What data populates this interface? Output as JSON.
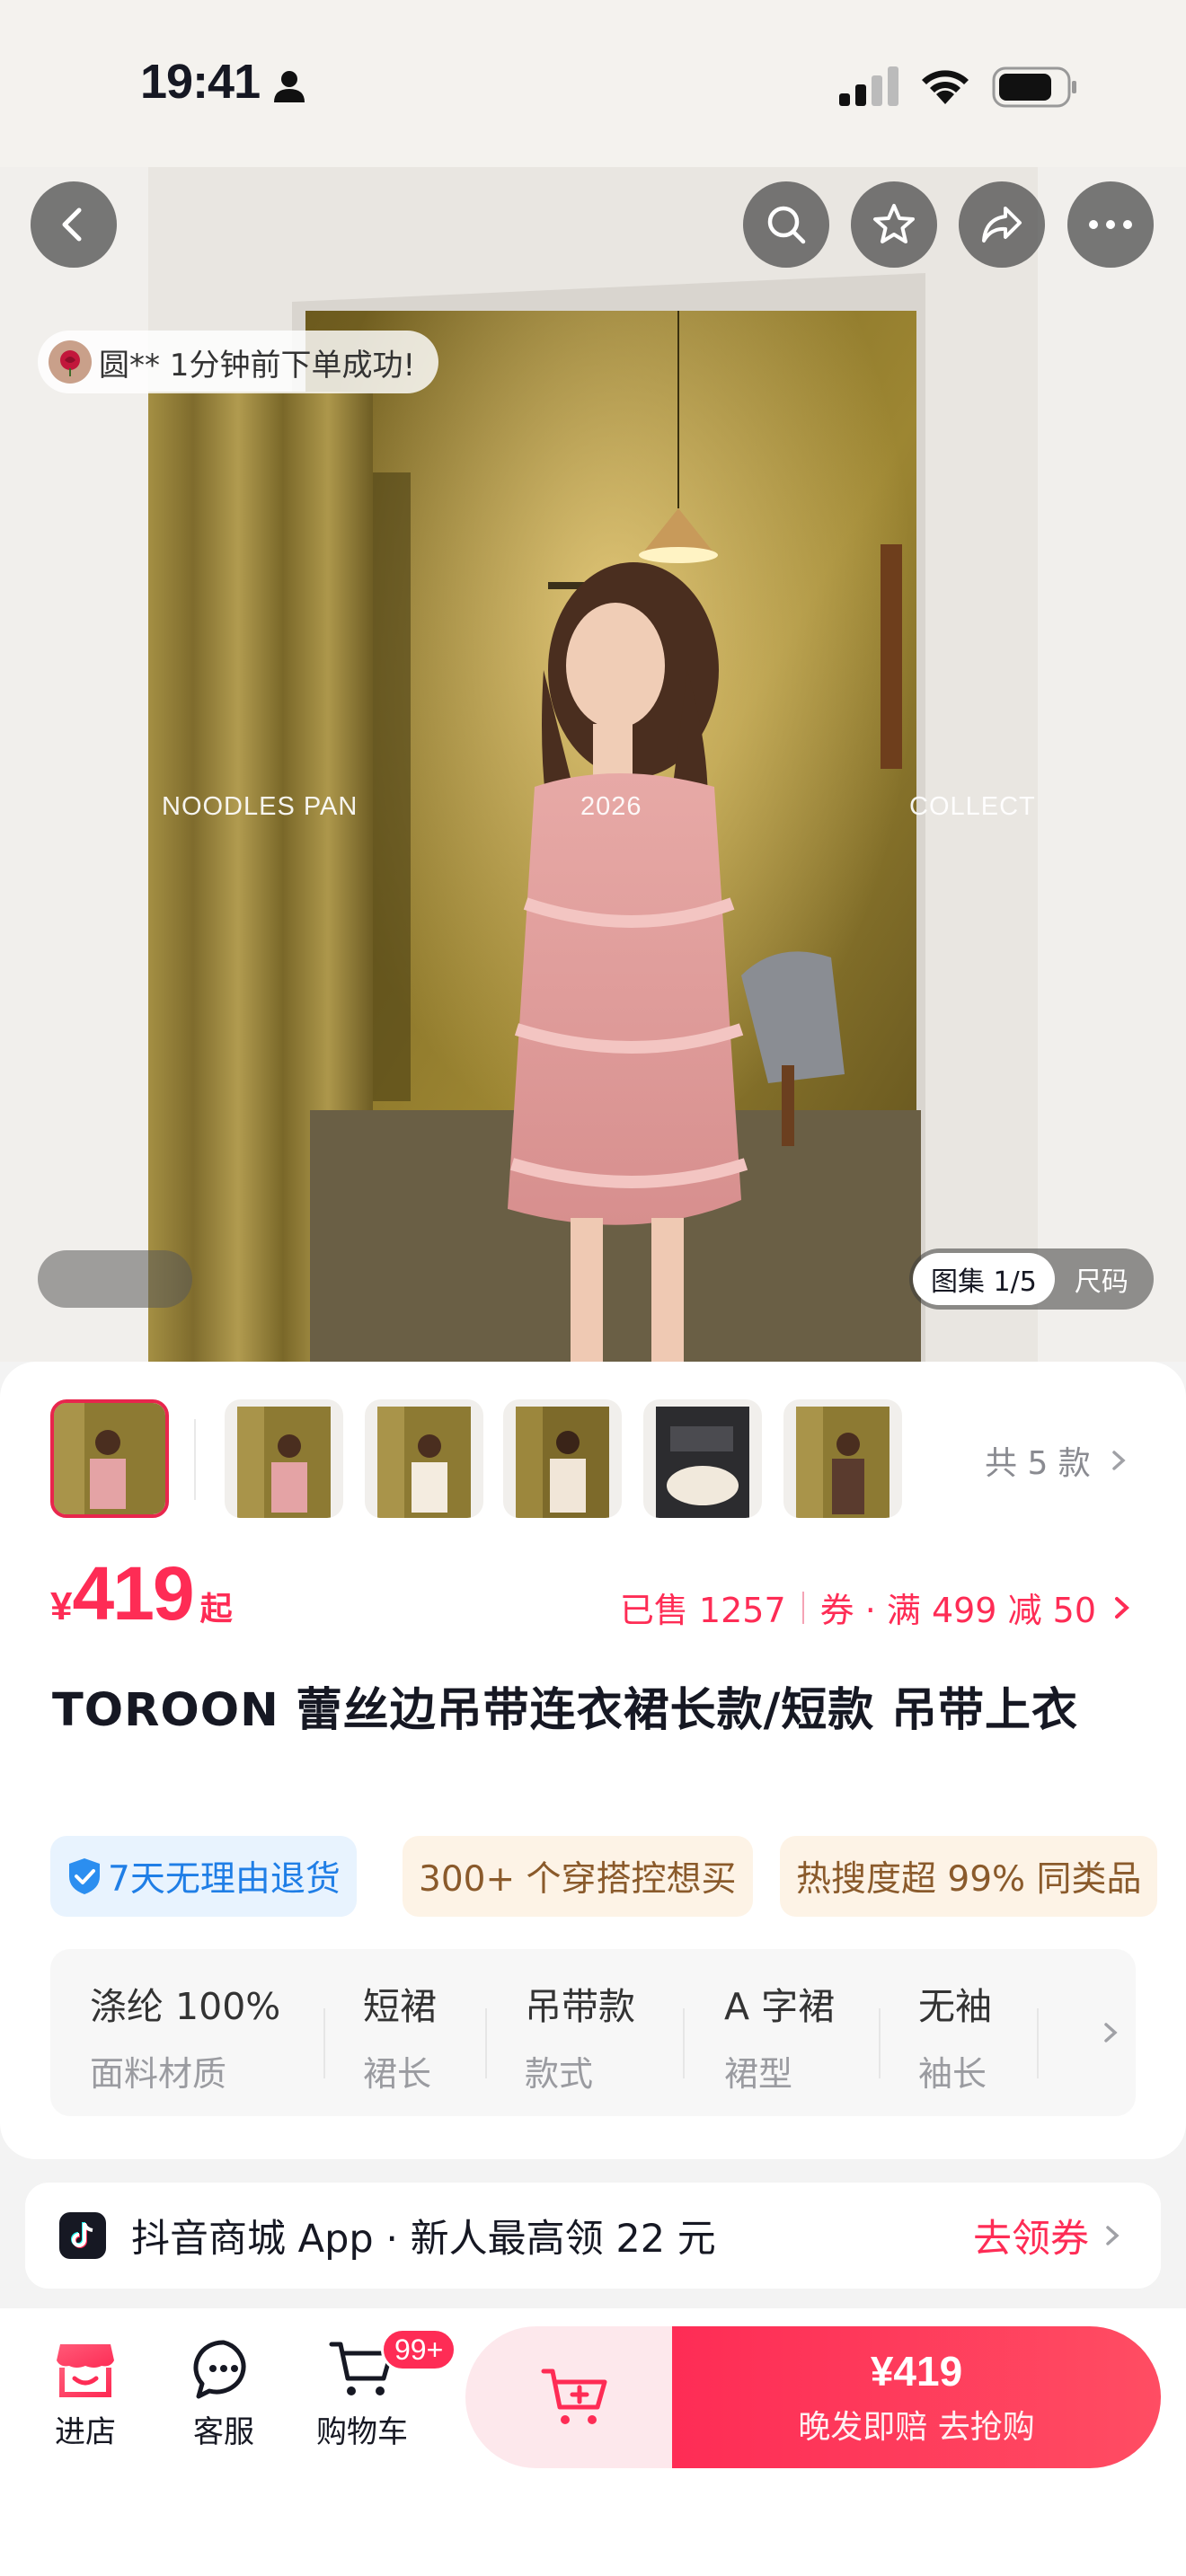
{
  "status_bar": {
    "time": "19:41"
  },
  "hero": {
    "order_toast": "圆** 1分钟前下单成功!",
    "overlay_texts": [
      "NOODLES  PAN",
      "2026",
      "COLLECT"
    ],
    "gallery_label": "图集 1/5",
    "size_label": "尺码",
    "top_icons": [
      "back-icon",
      "search-icon",
      "star-icon",
      "share-icon",
      "more-icon"
    ]
  },
  "product": {
    "variants_label": "共 5 款",
    "price_symbol": "¥",
    "price": "419",
    "price_suffix": "起",
    "sold": "已售 1257",
    "coupon": "券 · 满 499 减 50",
    "title": "TOROON 蕾丝边吊带连衣裙长款/短款 吊带上衣",
    "tags": [
      "7天无理由退货",
      "300+ 个穿搭控想买",
      "热搜度超 99% 同类品"
    ],
    "attributes": [
      {
        "value": "涤纶 100%",
        "key": "面料材质"
      },
      {
        "value": "短裙",
        "key": "裙长"
      },
      {
        "value": "吊带款",
        "key": "款式"
      },
      {
        "value": "A 字裙",
        "key": "裙型"
      },
      {
        "value": "无袖",
        "key": "袖长"
      }
    ]
  },
  "banner": {
    "text": "抖音商城 App · 新人最高领 22 元",
    "link": "去领券"
  },
  "bottom_bar": {
    "store": "进店",
    "service": "客服",
    "cart": "购物车",
    "cart_badge": "99+",
    "buy_price": "¥419",
    "buy_label": "晚发即赔  去抢购"
  },
  "colors": {
    "accent": "#fe2c55",
    "blue_tag": "#1f7ee6"
  }
}
